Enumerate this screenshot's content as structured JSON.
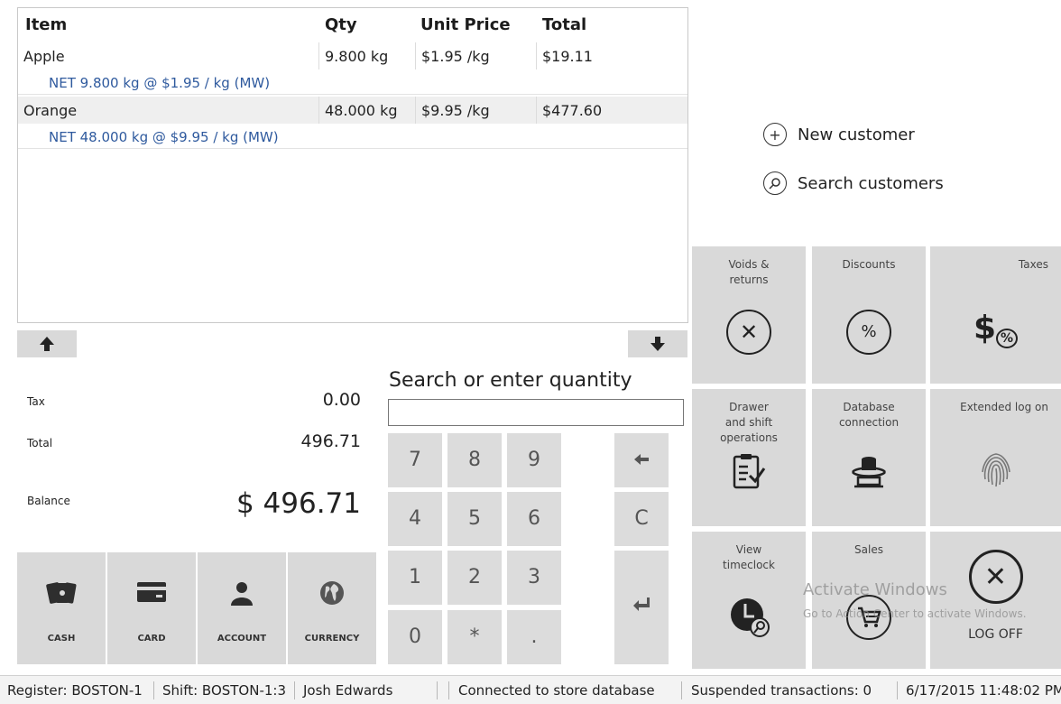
{
  "grid": {
    "headers": {
      "item": "Item",
      "qty": "Qty",
      "unit_price": "Unit Price",
      "total": "Total"
    },
    "rows": [
      {
        "item": "Apple",
        "qty": "9.800 kg",
        "unit_price": "$1.95 /kg",
        "total": "$19.11",
        "net": "NET 9.800 kg  @ $1.95 / kg (MW)"
      },
      {
        "item": "Orange",
        "qty": "48.000 kg",
        "unit_price": "$9.95 /kg",
        "total": "$477.60",
        "net": "NET 48.000 kg  @ $9.95 / kg (MW)"
      }
    ],
    "scroll_up_icon": "arrow-up-icon",
    "scroll_down_icon": "arrow-down-icon"
  },
  "totals": {
    "tax_label": "Tax",
    "tax_value": "0.00",
    "total_label": "Total",
    "total_value": "496.71",
    "balance_label": "Balance",
    "balance_value": "$ 496.71"
  },
  "payments": [
    {
      "label": "CASH",
      "icon": "cash-icon"
    },
    {
      "label": "CARD",
      "icon": "card-icon"
    },
    {
      "label": "ACCOUNT",
      "icon": "account-icon"
    },
    {
      "label": "CURRENCY",
      "icon": "globe-icon"
    }
  ],
  "search": {
    "label": "Search or enter quantity",
    "value": ""
  },
  "keypad": {
    "k7": "7",
    "k8": "8",
    "k9": "9",
    "backspace": "←",
    "k4": "4",
    "k5": "5",
    "k6": "6",
    "clear": "C",
    "k1": "1",
    "k2": "2",
    "k3": "3",
    "enter": "↵",
    "k0": "0",
    "star": "*",
    "dot": "."
  },
  "customer": {
    "new_label": "New customer",
    "search_label": "Search customers"
  },
  "tiles": {
    "voids": "Voids & returns",
    "discounts": "Discounts",
    "taxes": "Taxes",
    "drawer": "Drawer and shift operations",
    "database": "Database connection",
    "extended": "Extended log on",
    "timeclock": "View timeclock",
    "sales": "Sales",
    "logoff": "LOG OFF"
  },
  "watermark": {
    "title": "Activate Windows",
    "subtitle": "Go to Action Center to activate Windows."
  },
  "status": {
    "register": "Register: BOSTON-1",
    "shift": "Shift: BOSTON-1:3",
    "user": "Josh Edwards",
    "connection": "Connected to store database",
    "suspended": "Suspended transactions: 0",
    "datetime": "6/17/2015 11:48:02 PM"
  }
}
